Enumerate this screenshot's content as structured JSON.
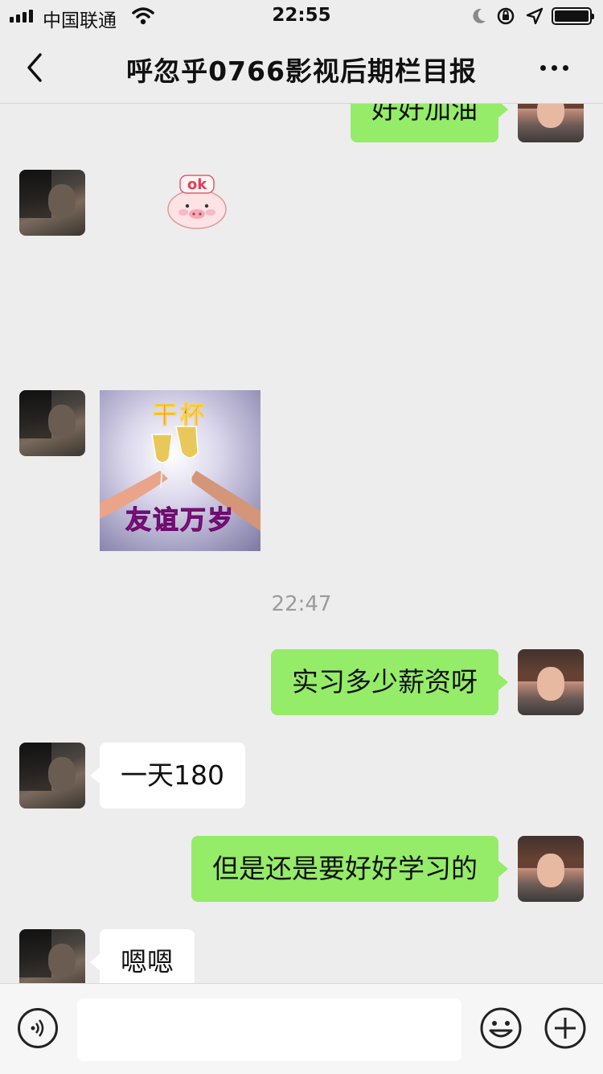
{
  "status_bar": {
    "carrier": "中国联通",
    "time": "22:55"
  },
  "nav": {
    "title": "呼忽乎0766影视后期栏目报"
  },
  "messages": [
    {
      "side": "right",
      "type": "text",
      "text": "好好加油"
    },
    {
      "side": "left",
      "type": "sticker",
      "sticker": "ok-pig-sticker",
      "text": "ok"
    },
    {
      "side": "left",
      "type": "sticker",
      "sticker": "cheers-sticker",
      "caption_top": "干杯",
      "caption_bottom": "友谊万岁"
    },
    {
      "type": "time",
      "text": "22:47"
    },
    {
      "side": "right",
      "type": "text",
      "text": "实习多少薪资呀"
    },
    {
      "side": "left",
      "type": "text",
      "text": "一天180"
    },
    {
      "side": "right",
      "type": "text",
      "text": "但是还是要好好学习的"
    },
    {
      "side": "left",
      "type": "text",
      "text": "嗯嗯"
    }
  ],
  "input_bar": {
    "placeholder": "",
    "icons": [
      "voice-icon",
      "emoji-icon",
      "plus-icon"
    ]
  },
  "colors": {
    "outgoing_bubble": "#95ec69",
    "incoming_bubble": "#ffffff",
    "background": "#ededed"
  }
}
